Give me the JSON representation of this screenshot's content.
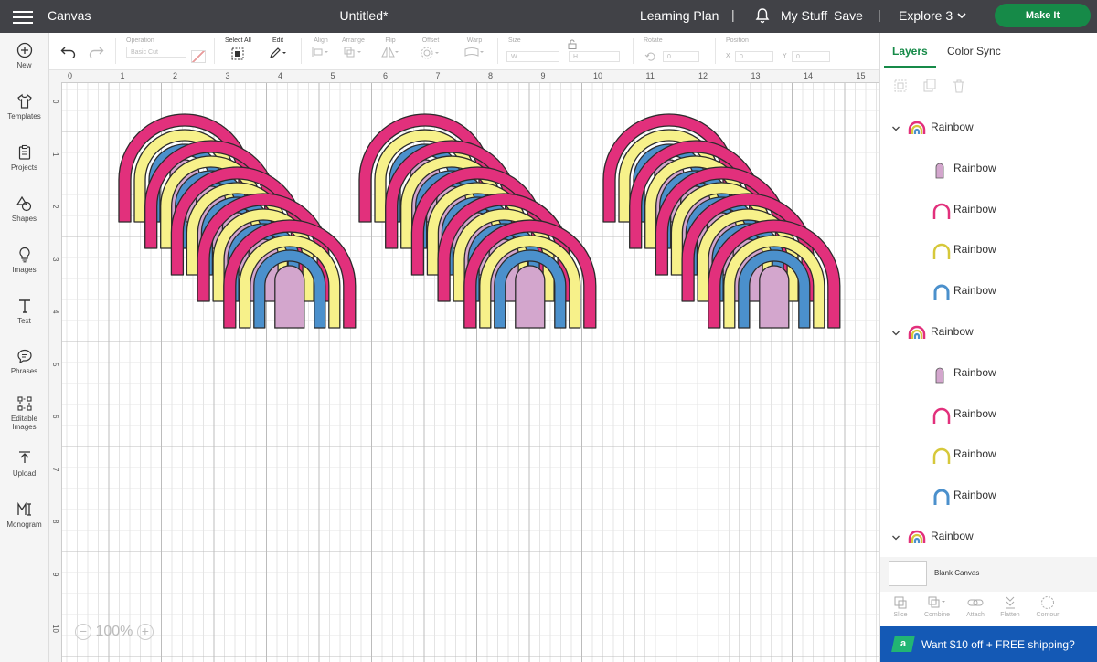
{
  "app": {
    "name": "Canvas",
    "doc_title": "Untitled*"
  },
  "header": {
    "learning_plan": "Learning Plan",
    "my_stuff": "My Stuff",
    "save": "Save",
    "machine": "Explore 3",
    "make_it": "Make It",
    "separator": "|"
  },
  "left_nav": [
    {
      "label": "New",
      "icon": "plus-circle-icon"
    },
    {
      "label": "Templates",
      "icon": "shirt-icon"
    },
    {
      "label": "Projects",
      "icon": "clipboard-icon"
    },
    {
      "label": "Shapes",
      "icon": "shapes-icon"
    },
    {
      "label": "Images",
      "icon": "lightbulb-icon"
    },
    {
      "label": "Text",
      "icon": "text-icon"
    },
    {
      "label": "Phrases",
      "icon": "speech-bubble-icon"
    },
    {
      "label": "Editable",
      "label2": "Images",
      "icon": "editable-images-icon"
    },
    {
      "label": "Upload",
      "icon": "upload-icon"
    },
    {
      "label": "Monogram",
      "icon": "monogram-icon"
    }
  ],
  "toolbar": {
    "operation_label": "Operation",
    "operation_value": "Basic Cut",
    "select_all": "Select All",
    "edit": "Edit",
    "align": "Align",
    "arrange": "Arrange",
    "flip": "Flip",
    "offset": "Offset",
    "warp": "Warp",
    "size": "Size",
    "w": "W",
    "h": "H",
    "rotate": "Rotate",
    "rotate_value": "0",
    "position": "Position",
    "x": "X",
    "x_value": "0",
    "y": "Y",
    "y_value": "0"
  },
  "ruler": {
    "top": [
      "0",
      "1",
      "2",
      "3",
      "4",
      "5",
      "6",
      "7",
      "8",
      "9",
      "10",
      "11",
      "12",
      "13",
      "14",
      "15"
    ],
    "left": [
      "0",
      "1",
      "2",
      "3",
      "4",
      "5",
      "6",
      "7",
      "8",
      "9",
      "10"
    ]
  },
  "zoom": {
    "value": "100%",
    "minus": "−",
    "plus": "+"
  },
  "rainbow_colors": {
    "pink": "#e2307c",
    "yellow": "#f7f18a",
    "blue": "#4b90cc",
    "lilac": "#d3a6cd",
    "outline": "#2b2b2b"
  },
  "panel": {
    "tabs": [
      "Layers",
      "Color Sync"
    ],
    "layers": [
      {
        "type": "group",
        "name": "Rainbow"
      },
      {
        "type": "child",
        "name": "Rainbow",
        "icon": "lilac-arch-icon"
      },
      {
        "type": "child",
        "name": "Rainbow",
        "icon": "pink-arc-icon"
      },
      {
        "type": "child",
        "name": "Rainbow",
        "icon": "yellow-arc-icon"
      },
      {
        "type": "child",
        "name": "Rainbow",
        "icon": "blue-arc-icon"
      },
      {
        "type": "group",
        "name": "Rainbow"
      },
      {
        "type": "child",
        "name": "Rainbow",
        "icon": "lilac-arch-icon"
      },
      {
        "type": "child",
        "name": "Rainbow",
        "icon": "pink-arc-icon"
      },
      {
        "type": "child",
        "name": "Rainbow",
        "icon": "yellow-arc-icon"
      },
      {
        "type": "child",
        "name": "Rainbow",
        "icon": "blue-arc-icon"
      },
      {
        "type": "group",
        "name": "Rainbow"
      }
    ],
    "blank_canvas": "Blank Canvas",
    "bottom_tools": [
      "Slice",
      "Combine",
      "Attach",
      "Flatten",
      "Contour"
    ],
    "promo": "Want $10 off + FREE shipping?",
    "promo_logo": "a"
  }
}
